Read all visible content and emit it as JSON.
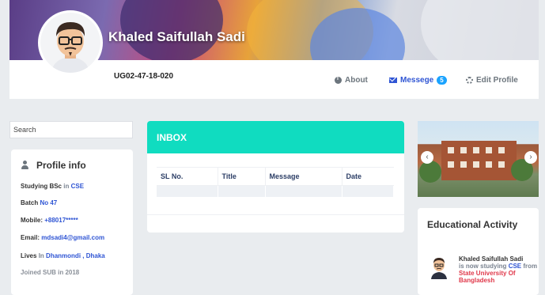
{
  "cover": {
    "name": "Khaled Saifullah Sadi"
  },
  "profile": {
    "user_id": "UG02-47-18-020",
    "nav": {
      "about": "About",
      "message": "Messege",
      "message_count": "5",
      "edit": "Edit Profile"
    }
  },
  "search": {
    "placeholder": "Search"
  },
  "profile_info": {
    "title": "Profile info",
    "studying_label": "Studying BSc",
    "studying_in": "in",
    "studying_value": "CSE",
    "batch_label": "Batch",
    "batch_value": "No 47",
    "mobile_label": "Mobile:",
    "mobile_value": "+88017*****",
    "email_label": "Email:",
    "email_value": "mdsadi4@gmail.com",
    "lives_label": "Lives",
    "lives_in": "In",
    "lives_value": "Dhanmondi , Dhaka",
    "joined": "Joined SUB in 2018"
  },
  "inbox": {
    "title": "INBOX",
    "columns": [
      "SL No.",
      "Title",
      "Message",
      "Date"
    ]
  },
  "carousel": {
    "prev": "‹",
    "next": "›"
  },
  "education": {
    "title": "Educational Activity",
    "name": "Khaled Saifullah Sadi",
    "text_prefix": "is now studying",
    "dept": "CSE",
    "text_from": "from",
    "institution": "State University Of Bangladesh"
  },
  "colors": {
    "accent": "#2f55d4",
    "inbox_header": "#10dcc0",
    "badge": "#1aa3ff",
    "institution": "#e0384a"
  }
}
